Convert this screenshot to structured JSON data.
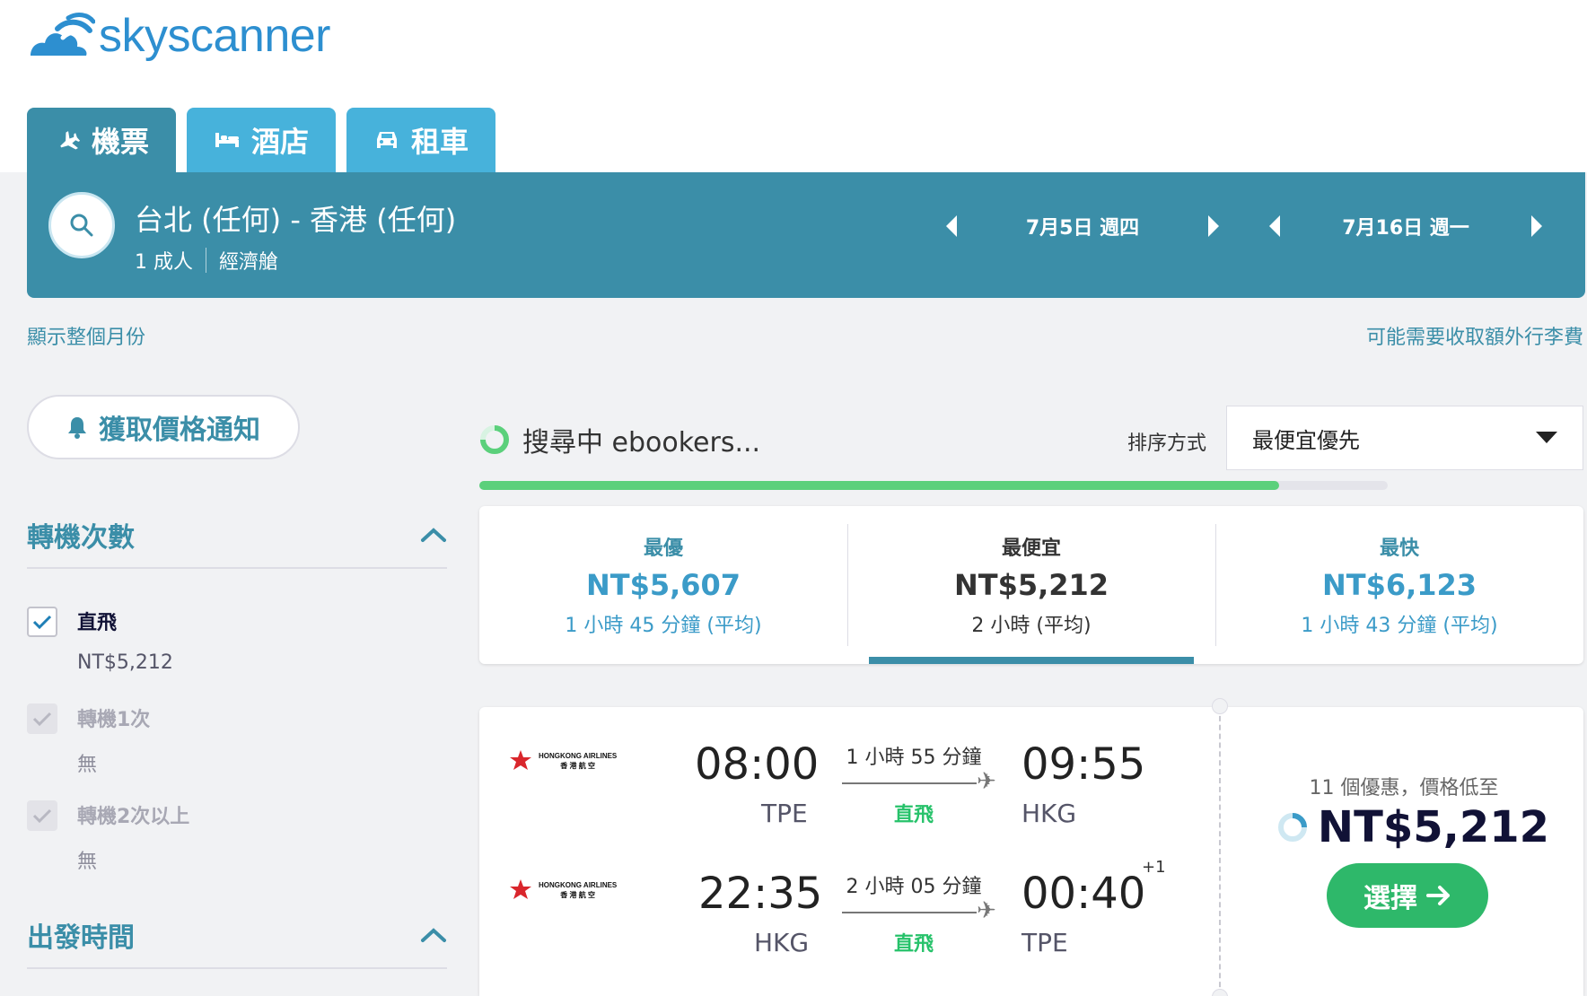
{
  "brand": {
    "name": "skyscanner"
  },
  "tabs": [
    {
      "label": "機票",
      "icon": "plane-icon",
      "active": true
    },
    {
      "label": "酒店",
      "icon": "bed-icon",
      "active": false
    },
    {
      "label": "租車",
      "icon": "car-icon",
      "active": false
    }
  ],
  "search": {
    "route": "台北 (任何) - 香港 (任何)",
    "passengers": "1 成人",
    "cabin": "經濟艙",
    "depart_date": "7月5日 週四",
    "return_date": "7月16日 週一"
  },
  "links": {
    "show_month": "顯示整個月份",
    "baggage_note": "可能需要收取額外行李費"
  },
  "sidebar": {
    "alert_button": "獲取價格通知",
    "stops_title": "轉機次數",
    "stops": [
      {
        "label": "直飛",
        "price": "NT$5,212",
        "checked": true,
        "disabled": false
      },
      {
        "label": "轉機1次",
        "price": "無",
        "checked": true,
        "disabled": true
      },
      {
        "label": "轉機2次以上",
        "price": "無",
        "checked": true,
        "disabled": true
      }
    ],
    "departure_title": "出發時間"
  },
  "results_header": {
    "searching_text": "搜尋中 ebookers...",
    "sort_label": "排序方式",
    "sort_value": "最便宜優先",
    "progress": 0.88
  },
  "summary": [
    {
      "title": "最優",
      "price": "NT$5,607",
      "duration": "1 小時 45 分鐘 (平均)",
      "selected": false
    },
    {
      "title": "最便宜",
      "price": "NT$5,212",
      "duration": "2 小時 (平均)",
      "selected": true
    },
    {
      "title": "最快",
      "price": "NT$6,123",
      "duration": "1 小時 43 分鐘 (平均)",
      "selected": false
    }
  ],
  "result": {
    "airline_line1": "HONGKONG AIRLINES",
    "airline_line2": "香 港 航 空",
    "outbound": {
      "depart": "08:00",
      "from": "TPE",
      "duration": "1 小時 55 分鐘",
      "stops": "直飛",
      "arrive": "09:55",
      "to": "HKG"
    },
    "inbound": {
      "depart": "22:35",
      "from": "HKG",
      "duration": "2 小時 05 分鐘",
      "stops": "直飛",
      "arrive": "00:40",
      "day_offset": "+1",
      "to": "TPE"
    },
    "deals": "11 個優惠，價格低至",
    "price": "NT$5,212",
    "select_label": "選擇"
  },
  "colors": {
    "brand_blue": "#3b8ea8",
    "tab_light": "#47b2db",
    "green": "#2eb86a",
    "progress": "#5bd07b"
  }
}
